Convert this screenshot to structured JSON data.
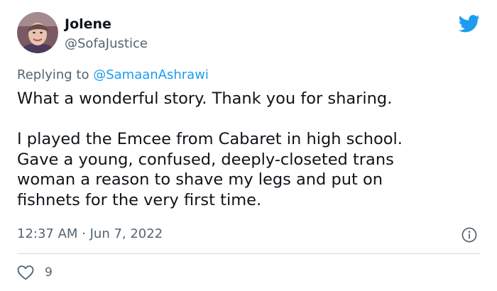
{
  "author": {
    "name": "Jolene",
    "handle": "@SofaJustice"
  },
  "reply": {
    "prefix": "Replying to",
    "mention": "@SamaanAshrawi"
  },
  "tweet": {
    "paragraphs": [
      {
        "lines": [
          "What a wonderful story. Thank you for sharing."
        ]
      },
      {
        "lines": [
          "I played the Emcee from Cabaret in high school.",
          "Gave a young, confused, deeply-closeted trans",
          "woman a reason to shave my legs and put on",
          "fishnets for the very first time."
        ]
      }
    ]
  },
  "meta": {
    "timestamp": "12:37 AM · Jun 7, 2022"
  },
  "engagement": {
    "likes": "9"
  },
  "icons": {
    "brand": "twitter-bird-icon",
    "info": "info-icon",
    "like": "heart-icon"
  },
  "colors": {
    "brand_blue": "#1d9bf0",
    "text": "#0f1419",
    "secondary_text": "#536471",
    "divider": "#cfd9de"
  }
}
